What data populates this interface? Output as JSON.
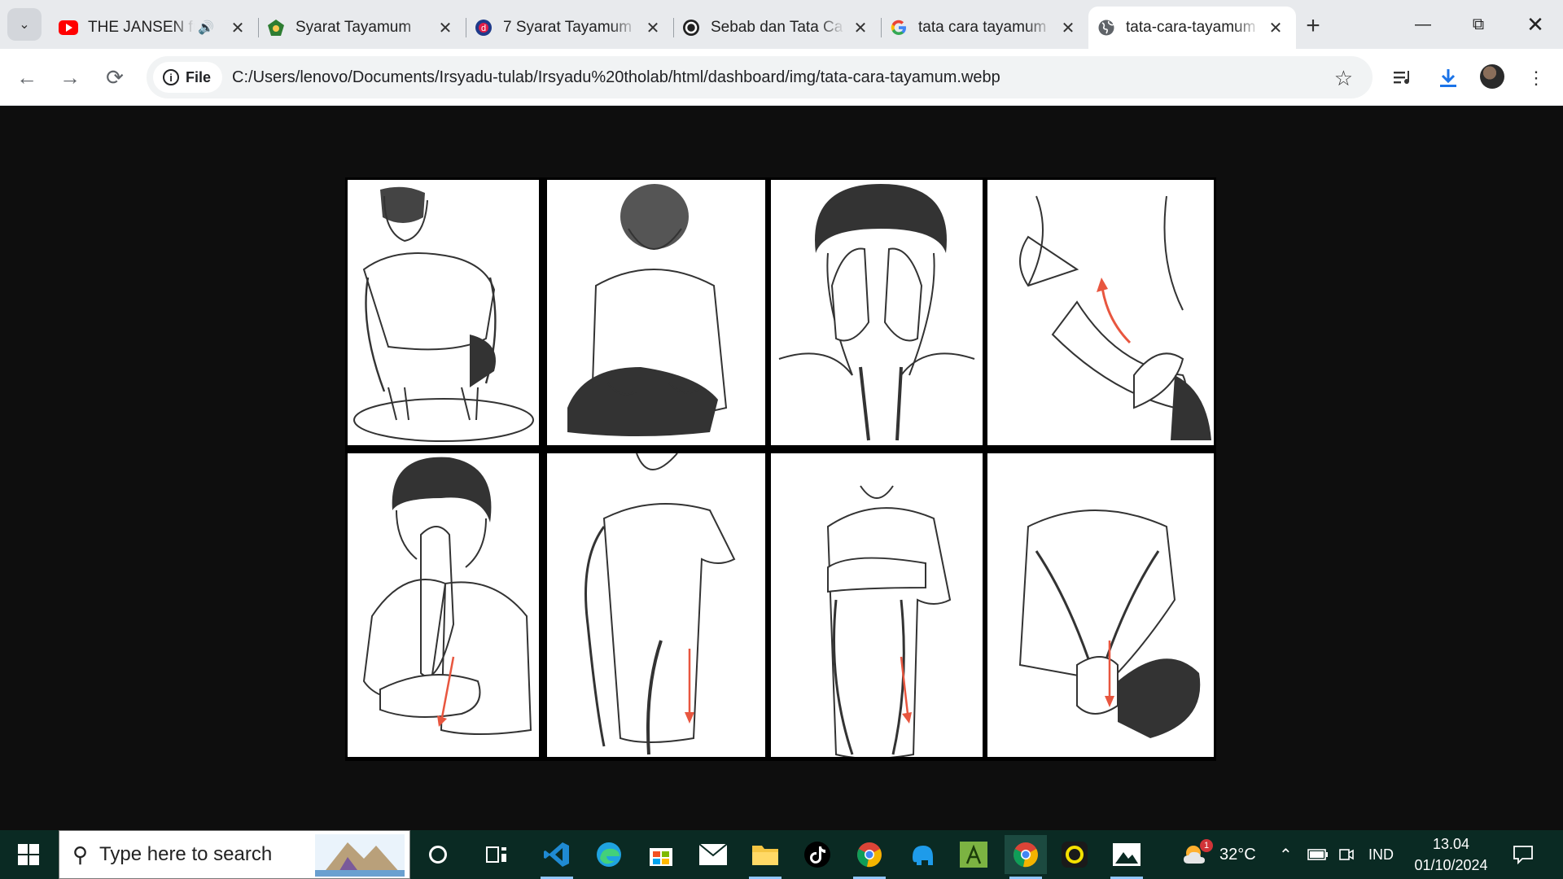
{
  "tabs": [
    {
      "title": "THE JANSEN fu",
      "favicon": "youtube-icon",
      "audio": true
    },
    {
      "title": "Syarat Tayamum",
      "favicon": "green-emblem-icon"
    },
    {
      "title": "7 Syarat Tayamum",
      "favicon": "detik-icon"
    },
    {
      "title": "Sebab dan Tata Ca",
      "favicon": "circle-logo-icon"
    },
    {
      "title": "tata cara tayamum",
      "favicon": "google-icon"
    },
    {
      "title": "tata-cara-tayamum",
      "favicon": "globe-icon",
      "active": true
    }
  ],
  "address_bar": {
    "scheme_label": "File",
    "url": "C:/Users/lenovo/Documents/Irsyadu-tulab/Irsyadu%20tholab/html/dashboard/img/tata-cara-tayamum.webp"
  },
  "image_panels": [
    {
      "name": "panel-strike-dust"
    },
    {
      "name": "panel-blow-palms"
    },
    {
      "name": "panel-wipe-face"
    },
    {
      "name": "panel-wipe-left-arm"
    },
    {
      "name": "panel-wipe-face-again"
    },
    {
      "name": "panel-wipe-right-arm"
    },
    {
      "name": "panel-wipe-forearm"
    },
    {
      "name": "panel-rub-hands"
    }
  ],
  "taskbar": {
    "search_placeholder": "Type here to search",
    "weather": "32°C",
    "weather_badge": "1",
    "language": "IND",
    "time": "13.04",
    "date": "01/10/2024"
  },
  "colors": {
    "tabstrip": "#e8eaed",
    "viewer_bg": "#0e0e0e",
    "taskbar": "#0a2a23",
    "arrow_red": "#e8563f"
  }
}
